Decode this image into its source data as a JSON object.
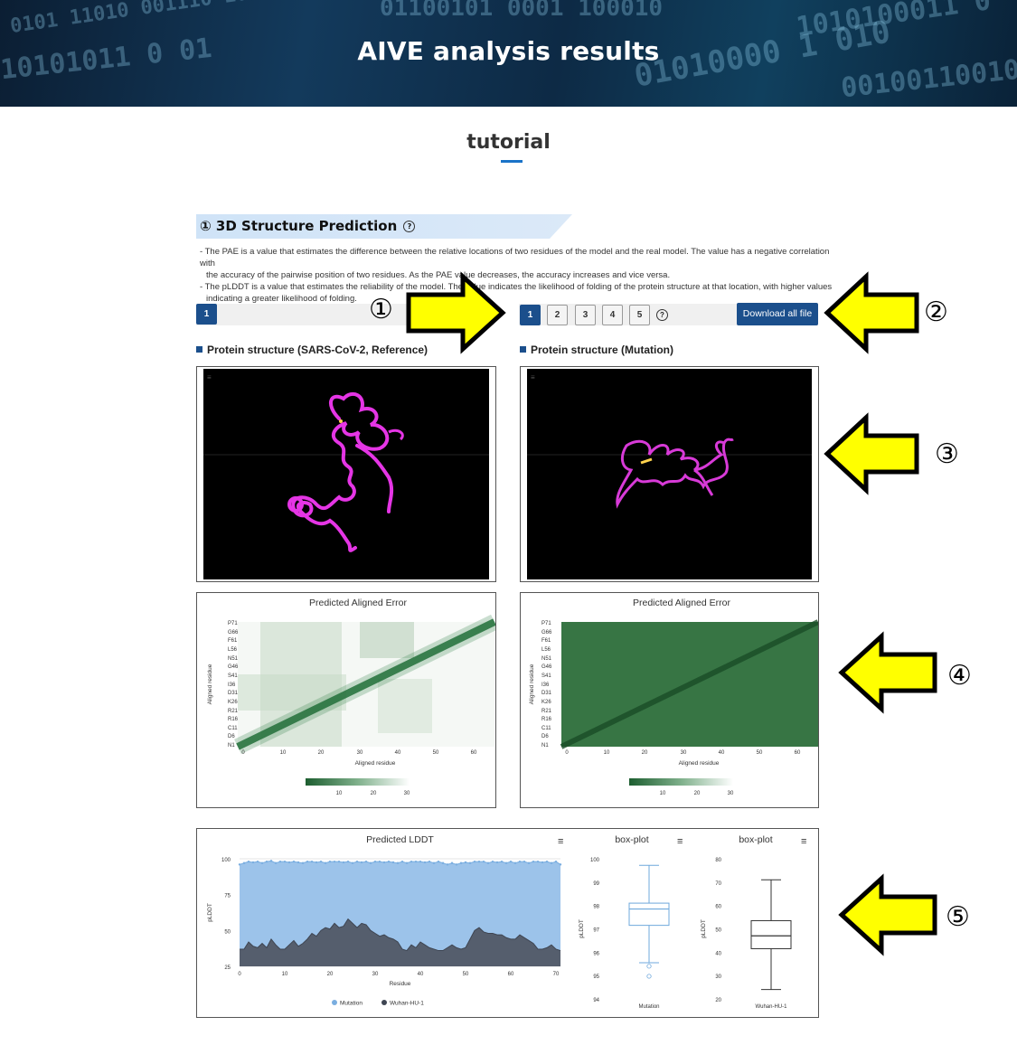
{
  "banner": {
    "title": "AIVE analysis results"
  },
  "tutorial": {
    "title": "tutorial"
  },
  "section": {
    "title": "① 3D Structure Prediction",
    "help_icon": "?",
    "desc_lines": [
      "- The PAE is a value that estimates the difference between the relative locations of two residues of the model and the real model. The value has a negative correlation with",
      "  the accuracy of the pairwise position of two residues. As the PAE value decreases, the accuracy increases and vice versa.",
      "- The pLDDT is a value that estimates the reliability of the model. The value indicates the likelihood of folding of the protein structure at that location, with higher values",
      "  indicating a greater likelihood of folding."
    ]
  },
  "left_tabs": {
    "items": [
      "1"
    ],
    "active": "1"
  },
  "right_tabs": {
    "items": [
      "1",
      "2",
      "3",
      "4",
      "5"
    ],
    "active": "1",
    "help_icon": "?"
  },
  "download_button": "Download all file",
  "ref_title": "Protein structure (SARS-CoV-2, Reference)",
  "mut_title": "Protein structure (Mutation)",
  "pae": {
    "title": "Predicted Aligned Error",
    "xlabel": "Aligned residue",
    "ylabel": "Aligned residue",
    "y_ticks": [
      "P71",
      "G66",
      "F61",
      "L56",
      "N51",
      "G46",
      "S41",
      "I36",
      "D31",
      "K26",
      "R21",
      "R16",
      "C11",
      "D6",
      "N1"
    ],
    "x_ticks": [
      "0",
      "10",
      "20",
      "30",
      "40",
      "50",
      "60"
    ],
    "colorbar_ticks": [
      "10",
      "20",
      "30"
    ]
  },
  "annotations": {
    "num1": "①",
    "num2": "②",
    "num3": "③",
    "num4": "④",
    "num5": "⑤"
  },
  "chart_data": [
    {
      "type": "area",
      "title": "Predicted LDDT",
      "xlabel": "Residue",
      "ylabel": "pLDDT",
      "xlim": [
        0,
        71
      ],
      "ylim": [
        25,
        100
      ],
      "x_ticks": [
        "0",
        "10",
        "20",
        "30",
        "40",
        "50",
        "60",
        "70"
      ],
      "y_ticks": [
        "25",
        "50",
        "75",
        "100"
      ],
      "legend_position": "bottom",
      "series": [
        {
          "name": "Mutation",
          "color": "#9cc3ea",
          "values": [
            96,
            97,
            98,
            97.5,
            98,
            97,
            98,
            98.5,
            97,
            98,
            98,
            97.5,
            98,
            97.5,
            97,
            98,
            98,
            97.5,
            98,
            97,
            98,
            98,
            98,
            97.5,
            98,
            97,
            98,
            97.5,
            98,
            97,
            98,
            98,
            97.5,
            98,
            97.5,
            97,
            98,
            97,
            98,
            98,
            98,
            97.5,
            98,
            97,
            98,
            97,
            96,
            97,
            96,
            97,
            97.5,
            97,
            98,
            98,
            98,
            97,
            98,
            97.5,
            98,
            97,
            98,
            97,
            98,
            98,
            97,
            98,
            98,
            97.5,
            98,
            97,
            98,
            96
          ]
        },
        {
          "name": "Wuhan-HU-1",
          "color": "#555e6d",
          "values": [
            37,
            37,
            42,
            39,
            38,
            41,
            38,
            44,
            40,
            37,
            37,
            40,
            43,
            39,
            41,
            44,
            48,
            46,
            50,
            52,
            51,
            55,
            52,
            53,
            58,
            55,
            52,
            55,
            54,
            50,
            48,
            46,
            47,
            45,
            44,
            42,
            37,
            36,
            40,
            38,
            42,
            40,
            38,
            37,
            36,
            36,
            38,
            40,
            38,
            37,
            38,
            44,
            50,
            52,
            49,
            48,
            48,
            47,
            47,
            45,
            44,
            44,
            47,
            45,
            43,
            41,
            37,
            37,
            38,
            40,
            37,
            36
          ]
        }
      ]
    },
    {
      "type": "box",
      "title": "box-plot",
      "categories": [
        "Mutation"
      ],
      "ylabel": "pLDDT",
      "ylim": [
        94,
        100
      ],
      "y_ticks": [
        "94",
        "95",
        "96",
        "97",
        "98",
        "99",
        "100"
      ],
      "color": "#6fa8dc",
      "stats": {
        "min": 95.55,
        "q1": 97.15,
        "median": 97.85,
        "q3": 98.1,
        "max": 99.72,
        "outliers": [
          95.4,
          94.97
        ]
      }
    },
    {
      "type": "box",
      "title": "box-plot",
      "categories": [
        "Wuhan-HU-1"
      ],
      "ylabel": "pLDDT",
      "ylim": [
        20,
        80
      ],
      "y_ticks": [
        "20",
        "30",
        "40",
        "50",
        "60",
        "70",
        "80"
      ],
      "color": "#333333",
      "stats": {
        "min": 24,
        "q1": 41.5,
        "median": 47,
        "q3": 53.5,
        "max": 71,
        "outliers": []
      }
    }
  ]
}
